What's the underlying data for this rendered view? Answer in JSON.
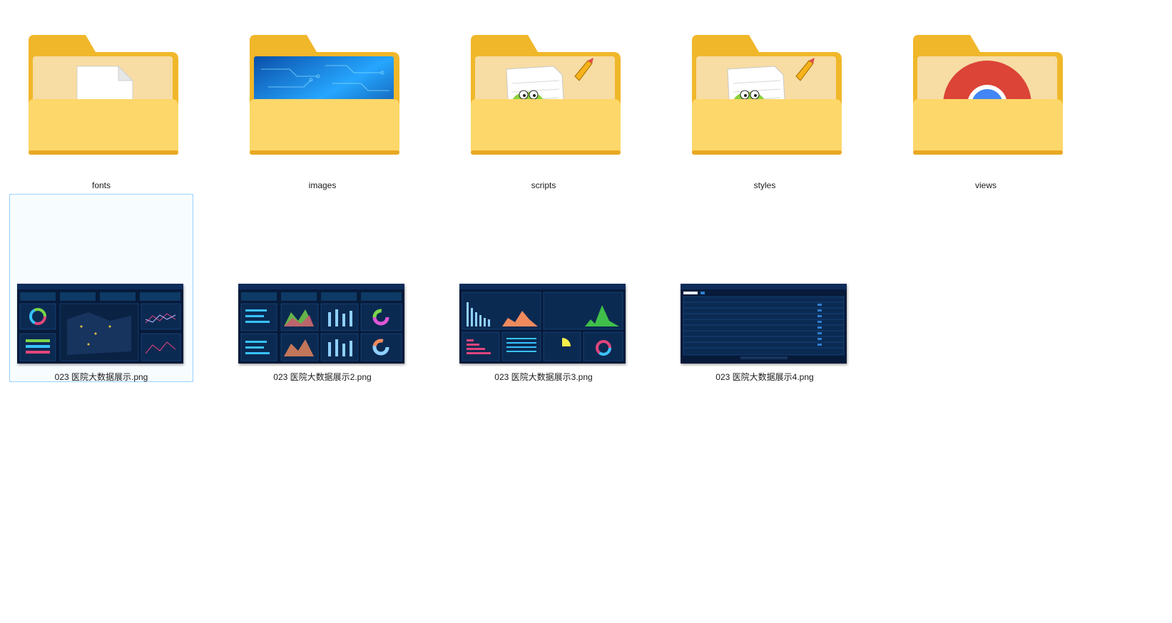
{
  "folders": [
    {
      "name": "fonts",
      "overlay": "blank-file"
    },
    {
      "name": "images",
      "overlay": "circuit-image"
    },
    {
      "name": "scripts",
      "overlay": "notepad-plus-plus"
    },
    {
      "name": "styles",
      "overlay": "notepad-plus-plus"
    },
    {
      "name": "views",
      "overlay": "chrome-logo"
    }
  ],
  "files": [
    {
      "name": "023 医院大数据展示.png",
      "selected": true
    },
    {
      "name": "023 医院大数据展示2.png",
      "selected": false
    },
    {
      "name": "023 医院大数据展示3.png",
      "selected": false
    },
    {
      "name": "023 医院大数据展示4.png",
      "selected": false
    }
  ],
  "colors": {
    "folder_back": "#f0b72a",
    "folder_front": "#fdd76a",
    "thumbnail_bg": "#071a3a",
    "selection_border": "#99d1ff"
  }
}
